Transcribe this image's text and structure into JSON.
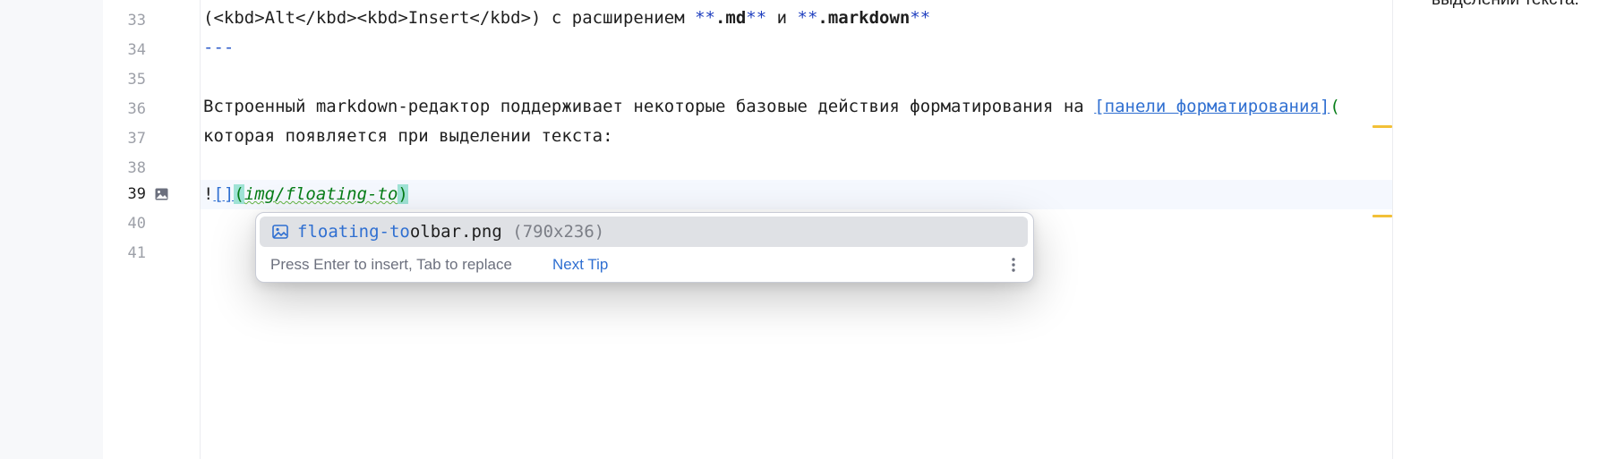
{
  "gutter": {
    "line_numbers": [
      "33",
      "34",
      "35",
      "36",
      "37",
      "38",
      "39",
      "40",
      "41"
    ]
  },
  "editor": {
    "line33": {
      "prefix": "(<kbd>Alt</kbd><kbd>Insert</kbd>) с расширением ",
      "md_open": "**",
      "md_ext": ".md",
      "md_close": "**",
      "and": " и ",
      "mk_open": "**",
      "mk_ext": ".markdown",
      "mk_close": "**"
    },
    "line34": {
      "text": "---"
    },
    "line36": {
      "text": "Встроенный markdown-редактор поддерживает некоторые базовые действия форматирования на ",
      "link": "[панели форматирования]",
      "after": "("
    },
    "line37": {
      "text": "которая появляется при выделении текста:"
    },
    "line39": {
      "bang": "!",
      "brackets": "[]",
      "open_paren": "(",
      "path": "img/floating-to",
      "close_paren": ")"
    }
  },
  "completion": {
    "item": {
      "match": "floating-to",
      "rest": "olbar.png",
      "dims": "(790x236)",
      "icon": "image-file-icon"
    },
    "hint": "Press Enter to insert, Tab to replace",
    "next_tip": "Next Tip",
    "more_icon": "vertical-ellipsis-icon"
  },
  "preview": {
    "text": "выделении текста."
  },
  "colors": {
    "accent": "#2f6fd1",
    "markdown_bold": "#1f3fbf",
    "path_green": "#067d17",
    "bracket_highlight": "#9fe3d6",
    "warning_stripe": "#f2c037"
  }
}
